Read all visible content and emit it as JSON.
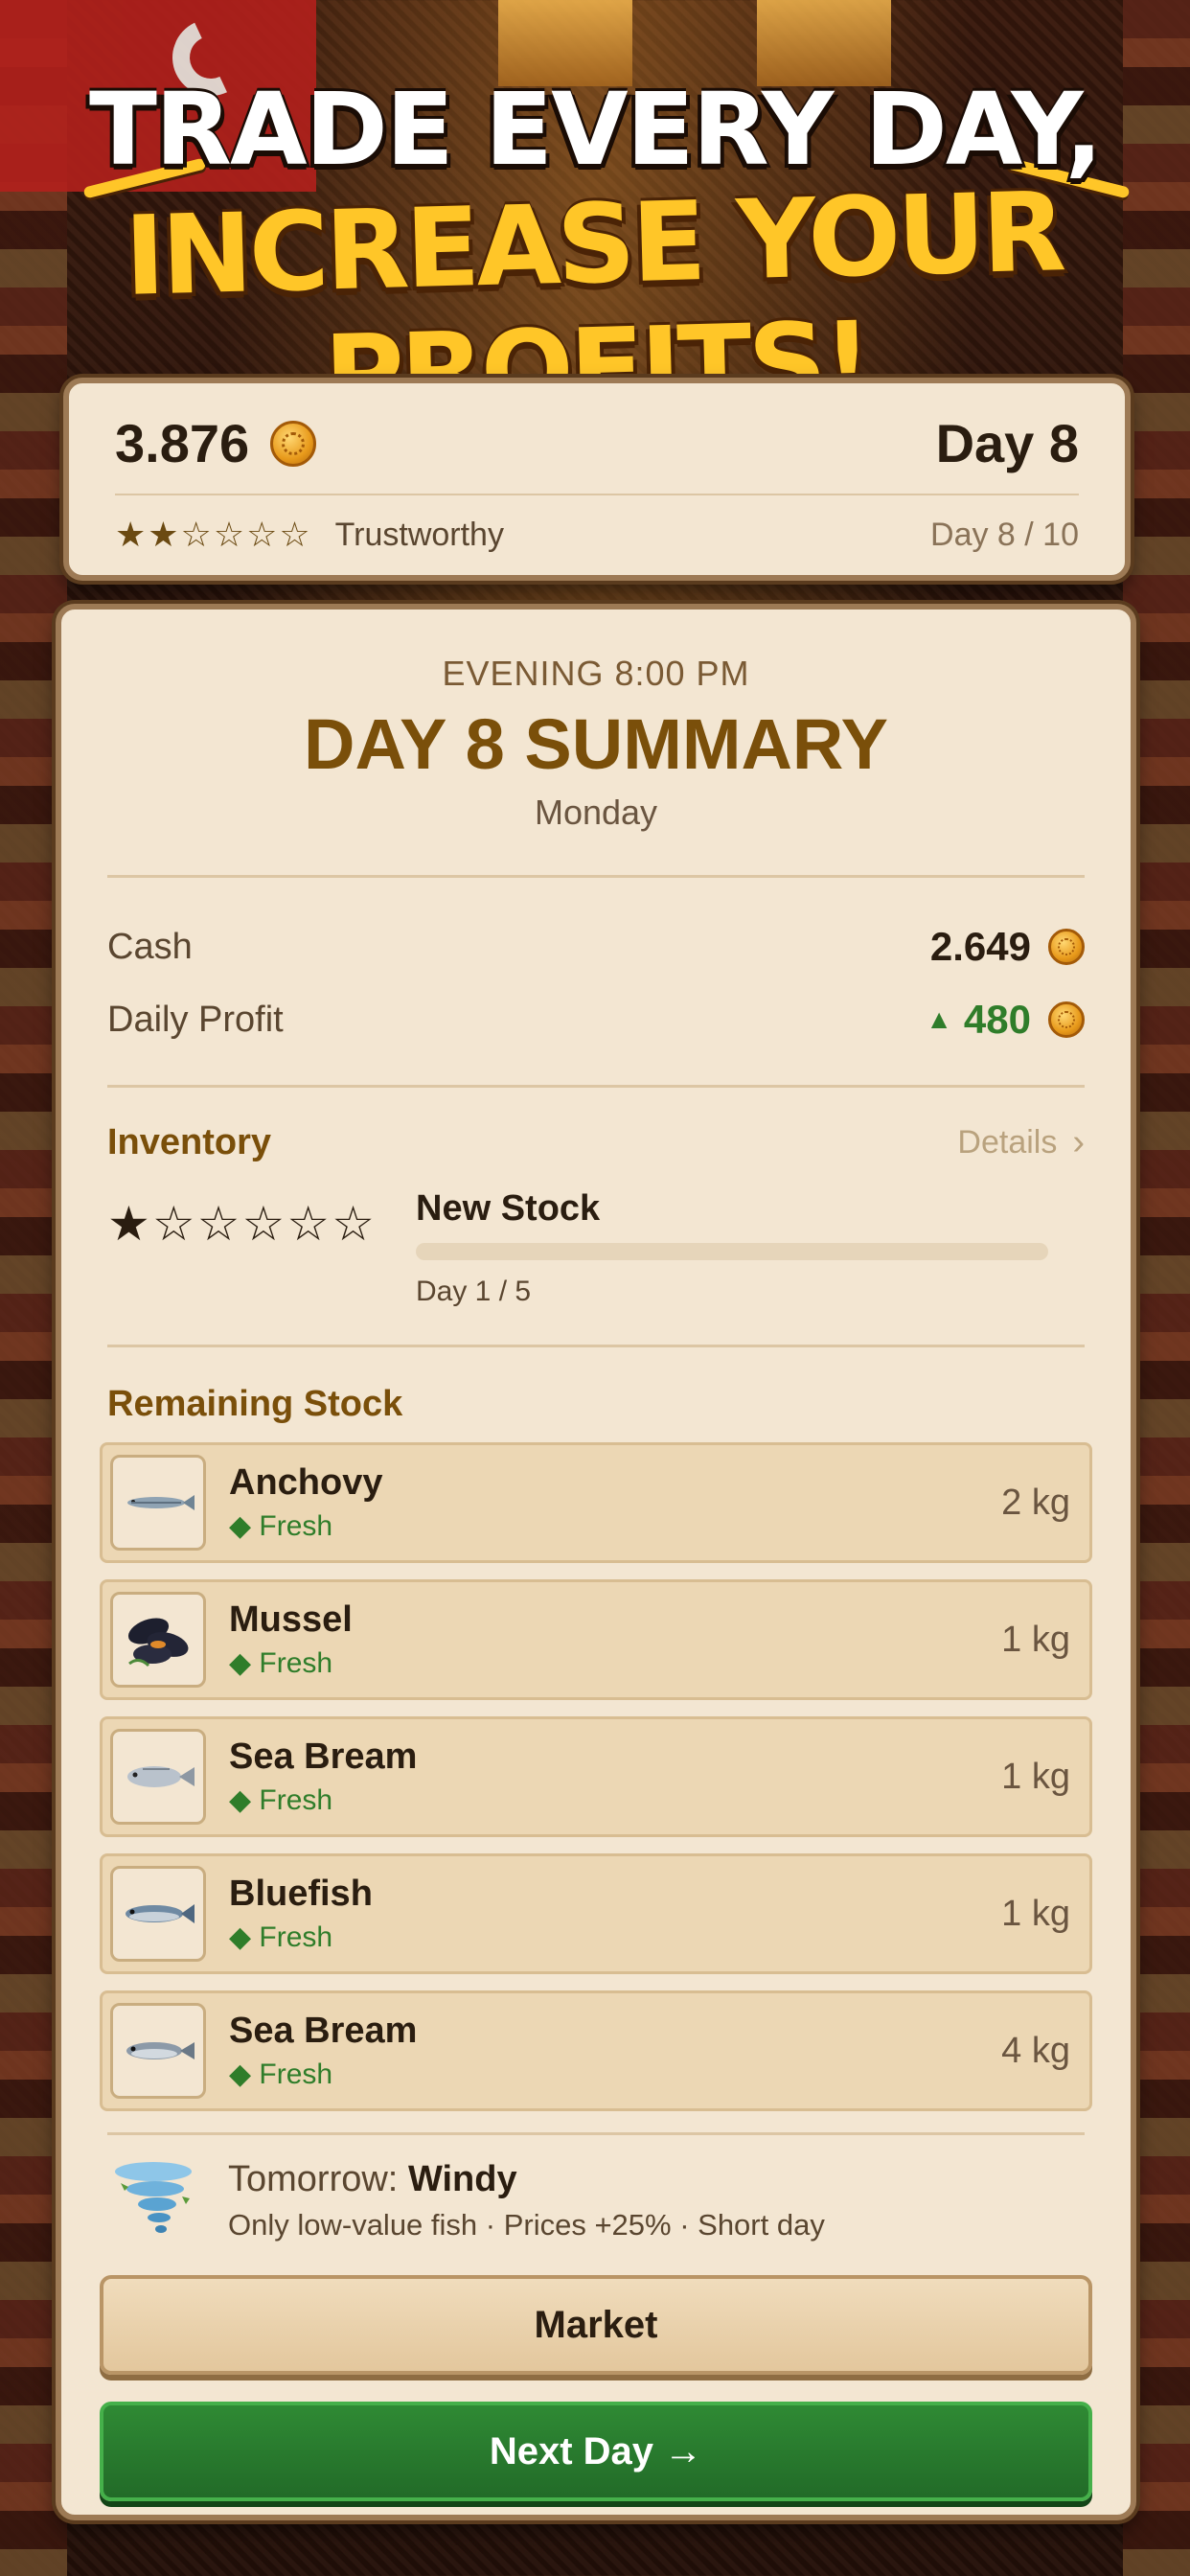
{
  "headline": {
    "line1": "TRADE EVERY DAY,",
    "line2": "INCREASE YOUR PROFITS!"
  },
  "status": {
    "money": "3.876",
    "day": "Day 8",
    "stars": "★★☆☆☆☆",
    "reputation": "Trustworthy",
    "day_progress": "Day 8 / 10"
  },
  "summary": {
    "time": "EVENING 8:00 PM",
    "title": "DAY 8 SUMMARY",
    "weekday": "Monday",
    "cash_label": "Cash",
    "cash_value": "2.649",
    "profit_label": "Daily Profit",
    "profit_arrow": "▲",
    "profit_value": "480"
  },
  "inventory": {
    "title": "Inventory",
    "details_label": "Details",
    "stars": "★☆☆☆☆☆",
    "stock_label": "New Stock",
    "progress_fraction": 0.0,
    "day_count": "Day 1 / 5"
  },
  "remaining": {
    "title": "Remaining Stock",
    "items": [
      {
        "name": "Anchovy",
        "status": "◆ Fresh",
        "qty": "2 kg",
        "icon": "anchovy-icon"
      },
      {
        "name": "Mussel",
        "status": "◆ Fresh",
        "qty": "1 kg",
        "icon": "mussel-icon"
      },
      {
        "name": "Sea Bream",
        "status": "◆ Fresh",
        "qty": "1 kg",
        "icon": "sea-bream-icon"
      },
      {
        "name": "Bluefish",
        "status": "◆ Fresh",
        "qty": "1 kg",
        "icon": "bluefish-icon"
      },
      {
        "name": "Sea Bream",
        "status": "◆ Fresh",
        "qty": "4 kg",
        "icon": "sea-bream-icon"
      }
    ]
  },
  "weather": {
    "prefix": "Tomorrow:",
    "condition": "Windy",
    "effects": "Only low-value fish · Prices +25% · Short day"
  },
  "buttons": {
    "market": "Market",
    "next_day": "Next Day →"
  },
  "colors": {
    "accent_gold": "#ffc628",
    "profit_green": "#2f7d2a",
    "title_brown": "#7a4f0a",
    "panel_bg": "#f3e6d2"
  }
}
